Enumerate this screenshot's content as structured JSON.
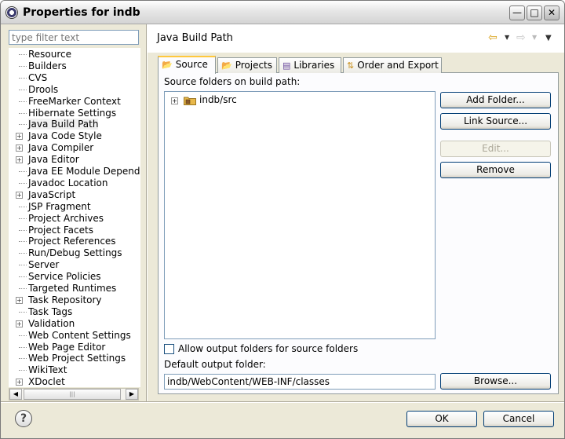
{
  "window": {
    "title": "Properties for indb"
  },
  "sidebar": {
    "filter_placeholder": "type filter text",
    "items": [
      {
        "label": "Resource",
        "expandable": false
      },
      {
        "label": "Builders",
        "expandable": false
      },
      {
        "label": "CVS",
        "expandable": false
      },
      {
        "label": "Drools",
        "expandable": false
      },
      {
        "label": "FreeMarker Context",
        "expandable": false
      },
      {
        "label": "Hibernate Settings",
        "expandable": false
      },
      {
        "label": "Java Build Path",
        "expandable": false,
        "selected": true
      },
      {
        "label": "Java Code Style",
        "expandable": true
      },
      {
        "label": "Java Compiler",
        "expandable": true
      },
      {
        "label": "Java Editor",
        "expandable": true
      },
      {
        "label": "Java EE Module Depende",
        "expandable": false
      },
      {
        "label": "Javadoc Location",
        "expandable": false
      },
      {
        "label": "JavaScript",
        "expandable": true
      },
      {
        "label": "JSP Fragment",
        "expandable": false
      },
      {
        "label": "Project Archives",
        "expandable": false
      },
      {
        "label": "Project Facets",
        "expandable": false
      },
      {
        "label": "Project References",
        "expandable": false
      },
      {
        "label": "Run/Debug Settings",
        "expandable": false
      },
      {
        "label": "Server",
        "expandable": false
      },
      {
        "label": "Service Policies",
        "expandable": false
      },
      {
        "label": "Targeted Runtimes",
        "expandable": false
      },
      {
        "label": "Task Repository",
        "expandable": true
      },
      {
        "label": "Task Tags",
        "expandable": false
      },
      {
        "label": "Validation",
        "expandable": true
      },
      {
        "label": "Web Content Settings",
        "expandable": false
      },
      {
        "label": "Web Page Editor",
        "expandable": false
      },
      {
        "label": "Web Project Settings",
        "expandable": false
      },
      {
        "label": "WikiText",
        "expandable": false
      },
      {
        "label": "XDoclet",
        "expandable": true
      }
    ]
  },
  "page": {
    "title": "Java Build Path",
    "tabs": [
      {
        "label": "Source",
        "icon": "folder-icon",
        "active": true
      },
      {
        "label": "Projects",
        "icon": "folder-icon"
      },
      {
        "label": "Libraries",
        "icon": "library-icon"
      },
      {
        "label": "Order and Export",
        "icon": "order-icon"
      }
    ],
    "source_folders_label": "Source folders on build path:",
    "source_folders": [
      "indb/src"
    ],
    "buttons": {
      "add_folder": "Add Folder...",
      "link_source": "Link Source...",
      "edit": "Edit...",
      "remove": "Remove",
      "browse": "Browse..."
    },
    "allow_output_label": "Allow output folders for source folders",
    "allow_output_checked": false,
    "default_output_label": "Default output folder:",
    "default_output_value": "indb/WebContent/WEB-INF/classes"
  },
  "footer": {
    "ok": "OK",
    "cancel": "Cancel"
  },
  "colors": {
    "active_tab_accent": "#ffc83c",
    "folder": "#e8b84a"
  }
}
